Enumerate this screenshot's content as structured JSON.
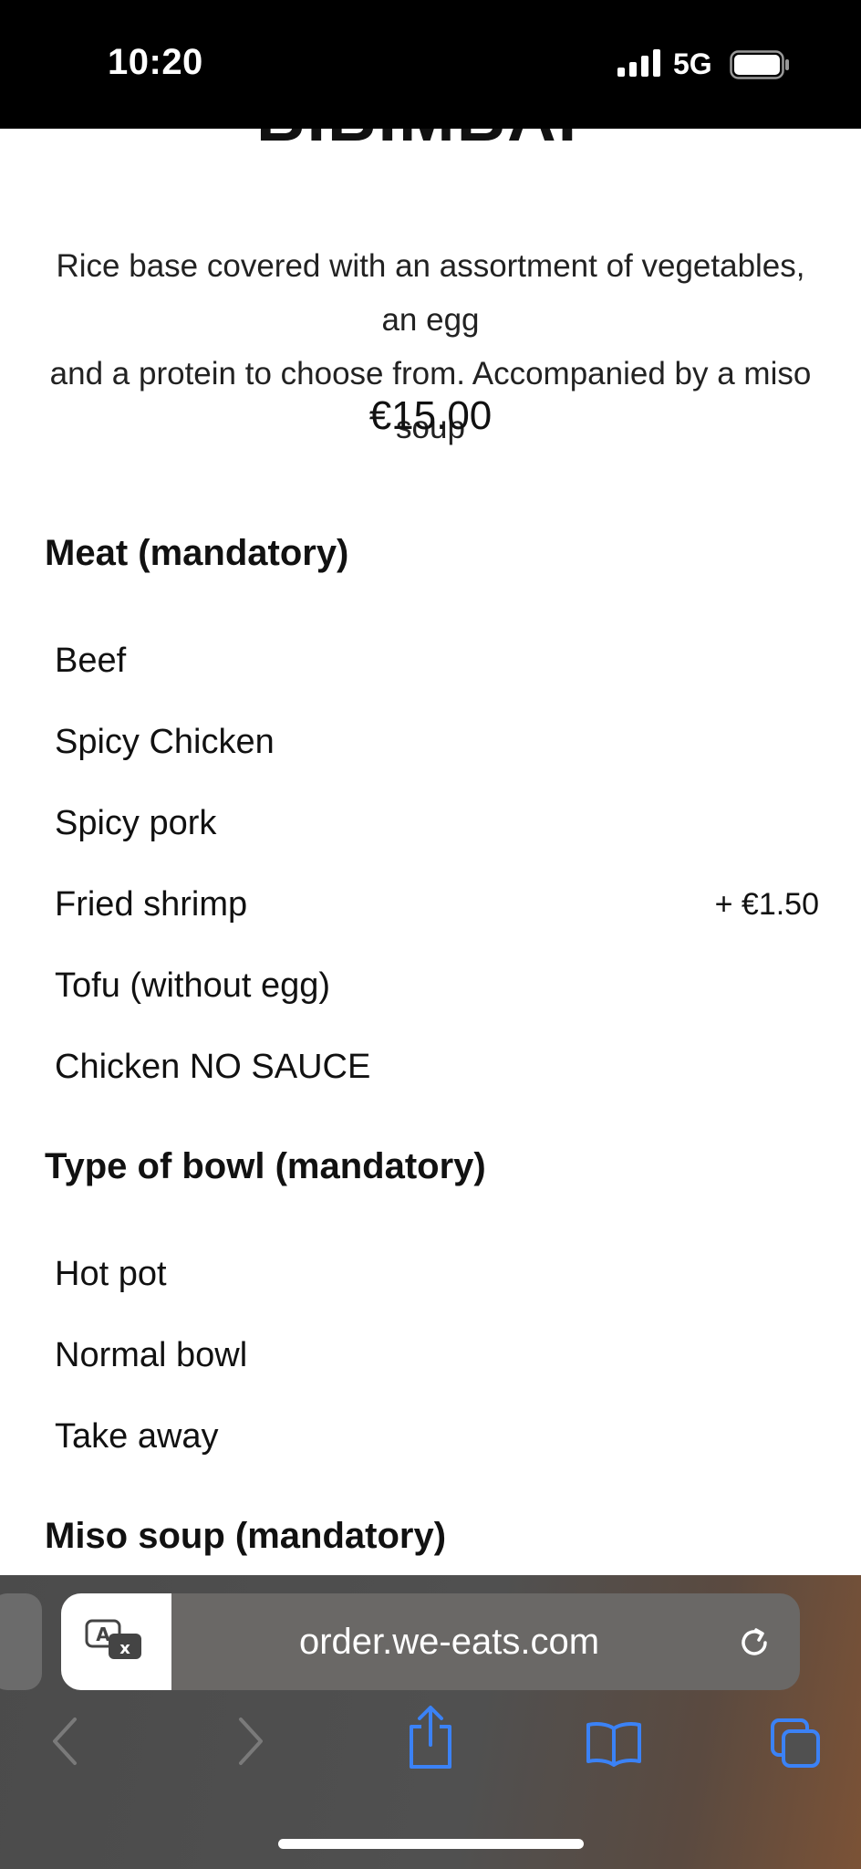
{
  "status_bar": {
    "time": "10:20",
    "network": "5G"
  },
  "item": {
    "title": "BIBIMBAP",
    "description_line1": "Rice base covered with an assortment of vegetables, an egg",
    "description_line2": "and a protein to choose from. Accompanied by a miso soup",
    "price": "€15.00"
  },
  "groups": {
    "meat": {
      "title": "Meat (mandatory)",
      "options": [
        {
          "label": "Beef",
          "extra": ""
        },
        {
          "label": "Spicy Chicken",
          "extra": ""
        },
        {
          "label": "Spicy pork",
          "extra": ""
        },
        {
          "label": "Fried shrimp",
          "extra": "+ €1.50"
        },
        {
          "label": "Tofu (without egg)",
          "extra": ""
        },
        {
          "label": "Chicken NO SAUCE",
          "extra": ""
        }
      ]
    },
    "bowl": {
      "title": "Type of bowl (mandatory)",
      "options": [
        {
          "label": "Hot pot"
        },
        {
          "label": "Normal bowl"
        },
        {
          "label": "Take away"
        }
      ]
    },
    "soup": {
      "title": "Miso soup (mandatory)"
    }
  },
  "browser": {
    "url": "order.we-eats.com",
    "icons": {
      "translate": "translate-icon",
      "reload": "reload-icon",
      "back": "chevron-left-icon",
      "forward": "chevron-right-icon",
      "share": "share-icon",
      "bookmarks": "book-icon",
      "tabs": "tabs-icon"
    },
    "accent_color": "#3b82f6",
    "disabled_color": "#7a7a7a"
  }
}
